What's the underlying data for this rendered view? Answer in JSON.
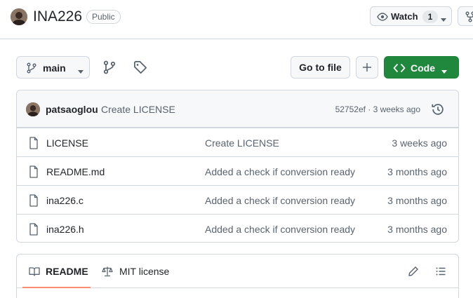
{
  "repo": {
    "name": "INA226",
    "visibility": "Public"
  },
  "header_actions": {
    "watch_label": "Watch",
    "watch_count": "1"
  },
  "toolbar": {
    "branch": "main",
    "goto_file": "Go to file",
    "code": "Code"
  },
  "latest_commit": {
    "author": "patsaoglou",
    "message": "Create LICENSE",
    "meta": "52752ef · 3 weeks ago"
  },
  "files": [
    {
      "name": "LICENSE",
      "message": "Create LICENSE",
      "date": "3 weeks ago"
    },
    {
      "name": "README.md",
      "message": "Added a check if conversion ready",
      "date": "3 months ago"
    },
    {
      "name": "ina226.c",
      "message": "Added a check if conversion ready",
      "date": "3 months ago"
    },
    {
      "name": "ina226.h",
      "message": "Added a check if conversion ready",
      "date": "3 months ago"
    }
  ],
  "readme_tabs": {
    "readme": "README",
    "license": "MIT license"
  },
  "colors": {
    "code_button": "#1f883d",
    "active_tab_underline": "#fd8c73",
    "border": "#d0d7de",
    "muted_text": "#59636e"
  }
}
